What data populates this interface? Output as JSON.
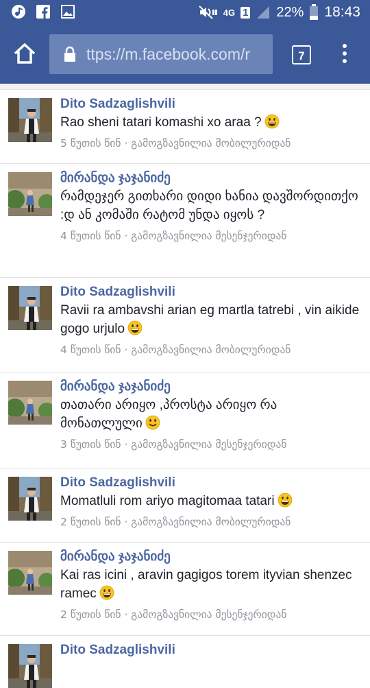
{
  "status_bar": {
    "network": "4G",
    "sim": "1",
    "battery": "22%",
    "time": "18:43",
    "icons": [
      "music-icon",
      "facebook-icon",
      "gallery-icon",
      "mute-icon",
      "signal-icon",
      "battery-icon"
    ]
  },
  "browser": {
    "url": "ttps://m.facebook.com/r",
    "tab_count": "7"
  },
  "comments": [
    {
      "author": "Dito Sadzaglishvili",
      "text": "Rao sheni tatari komashi xo araa ?",
      "emoji": "grin",
      "time": "5 წუთის წინ",
      "via": "გამოგზავნილია მობილურიდან",
      "avatar": "a"
    },
    {
      "author": "მირანდა ჯაჯანიძე",
      "text": "რამდეჯერ გითხარი დიდი ხანია დავშორდითქო :დ ან კომაში რატომ უნდა იყოს ?",
      "emoji": "",
      "time": "4 წუთის წინ",
      "via": "გამოგზავნილია მესენჯერიდან",
      "avatar": "b"
    },
    {
      "author": "Dito Sadzaglishvili",
      "text": "Ravii ra ambavshi arian eg martla tatrebi , vin aikide gogo urjulo",
      "emoji": "grin",
      "time": "4 წუთის წინ",
      "via": "გამოგზავნილია მობილურიდან",
      "avatar": "a"
    },
    {
      "author": "მირანდა ჯაჯანიძე",
      "text": "თათარი არიყო ,პროსტა არიყო რა მონათლული",
      "emoji": "smile",
      "time": "3 წუთის წინ",
      "via": "გამოგზავნილია მესენჯერიდან",
      "avatar": "b"
    },
    {
      "author": "Dito Sadzaglishvili",
      "text": "Momatluli rom ariyo magitomaa tatari",
      "emoji": "grin",
      "time": "2 წუთის წინ",
      "via": "გამოგზავნილია მობილურიდან",
      "avatar": "a"
    },
    {
      "author": "მირანდა ჯაჯანიძე",
      "text": "Kai ras icini , aravin gagigos torem ityvian shenzec ramec",
      "emoji": "grin",
      "time": "2 წუთის წინ",
      "via": "გამოგზავნილია მესენჯერიდან",
      "avatar": "b"
    },
    {
      "author": "Dito Sadzaglishvili",
      "text": "",
      "emoji": "",
      "time": "",
      "via": "",
      "avatar": "a"
    }
  ],
  "separator": " · "
}
